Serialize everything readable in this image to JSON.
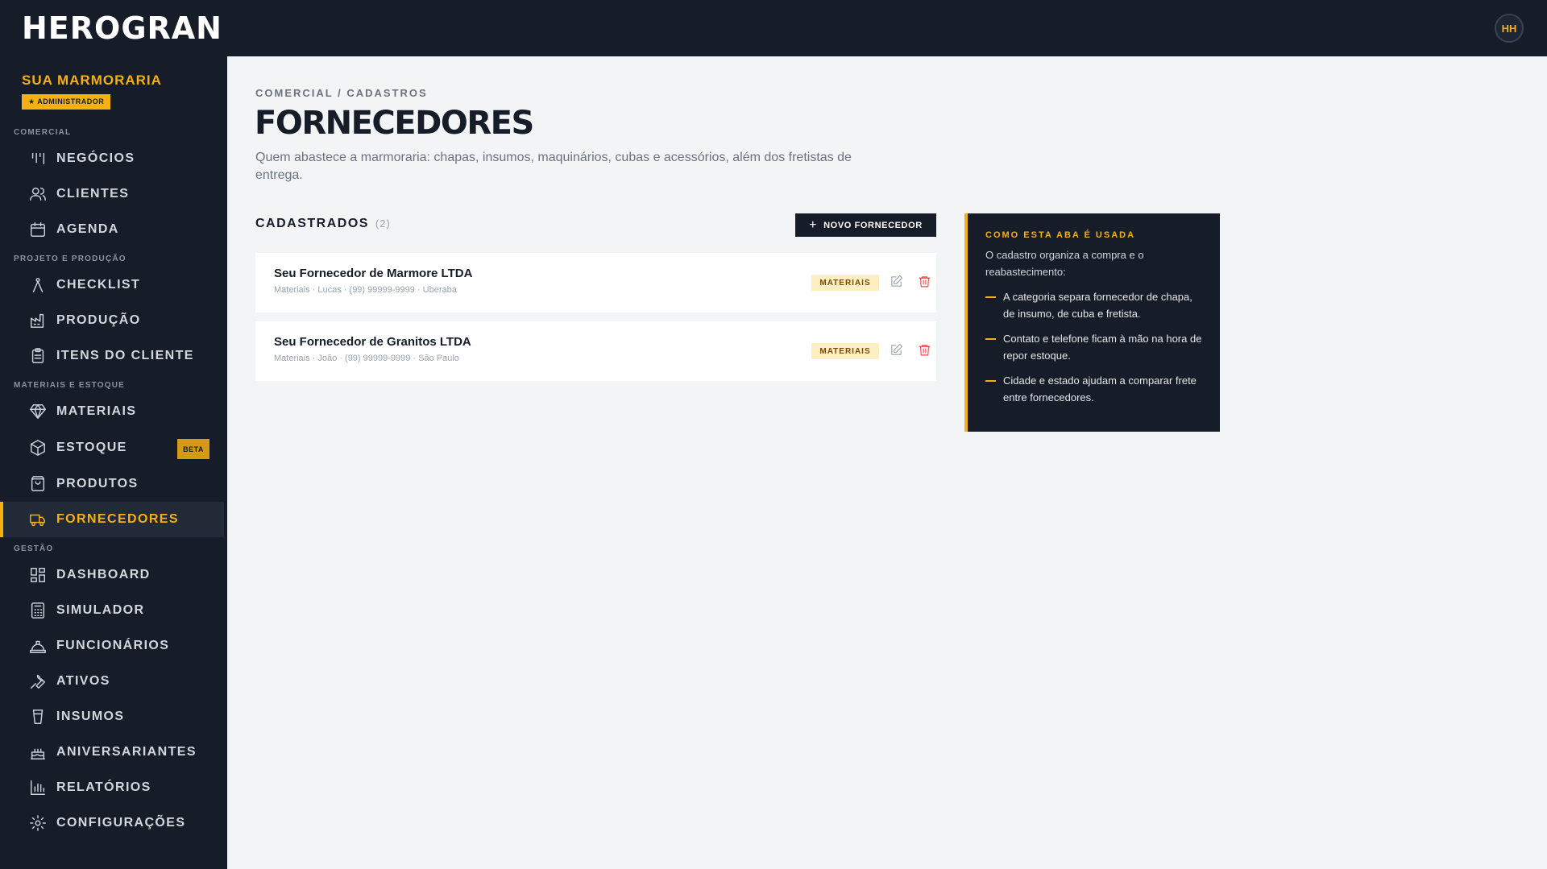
{
  "app": {
    "logo": "HEROGRAN",
    "user_initials": "HH"
  },
  "org": {
    "name": "SUA MARMORARIA",
    "role": "★ ADMINISTRADOR"
  },
  "nav": {
    "comercial": {
      "title": "COMERCIAL",
      "items": [
        {
          "label": "NEGÓCIOS",
          "icon": "kanban-icon"
        },
        {
          "label": "CLIENTES",
          "icon": "users-icon"
        },
        {
          "label": "AGENDA",
          "icon": "calendar-icon"
        }
      ]
    },
    "projeto": {
      "title": "PROJETO E PRODUÇÃO",
      "items": [
        {
          "label": "CHECKLIST",
          "icon": "compass-icon"
        },
        {
          "label": "PRODUÇÃO",
          "icon": "factory-icon"
        },
        {
          "label": "ITENS DO CLIENTE",
          "icon": "clipboard-icon"
        }
      ]
    },
    "materiais": {
      "title": "MATERIAIS E ESTOQUE",
      "items": [
        {
          "label": "MATERIAIS",
          "icon": "gem-icon"
        },
        {
          "label": "ESTOQUE",
          "icon": "box-icon",
          "badge": "BETA"
        },
        {
          "label": "PRODUTOS",
          "icon": "shopping-bag-icon"
        },
        {
          "label": "FORNECEDORES",
          "icon": "truck-icon",
          "active": true
        }
      ]
    },
    "gestao": {
      "title": "GESTÃO",
      "items": [
        {
          "label": "DASHBOARD",
          "icon": "dashboard-icon"
        },
        {
          "label": "SIMULADOR",
          "icon": "calculator-icon"
        },
        {
          "label": "FUNCIONÁRIOS",
          "icon": "hard-hat-icon"
        },
        {
          "label": "ATIVOS",
          "icon": "wrench-icon"
        },
        {
          "label": "INSUMOS",
          "icon": "cup-icon"
        },
        {
          "label": "ANIVERSARIANTES",
          "icon": "cake-icon"
        },
        {
          "label": "RELATÓRIOS",
          "icon": "bar-chart-icon"
        },
        {
          "label": "CONFIGURAÇÕES",
          "icon": "settings-icon"
        }
      ]
    }
  },
  "page": {
    "breadcrumb": "COMERCIAL / CADASTROS",
    "title": "FORNECEDORES",
    "description": "Quem abastece a marmoraria: chapas, insumos, maquinários, cubas e acessórios, além dos fretistas de entrega."
  },
  "list": {
    "title": "CADASTRADOS",
    "count": "(2)",
    "new_button": "NOVO FORNECEDOR",
    "suppliers": [
      {
        "name": "Seu Fornecedor de Marmore LTDA",
        "meta": "Materiais · Lucas · (99) 99999-9999 · Uberaba",
        "tag": "MATERIAIS"
      },
      {
        "name": "Seu Fornecedor de Granitos LTDA",
        "meta": "Materiais · João · (99) 99999-9999 · São Paulo",
        "tag": "MATERIAIS"
      }
    ]
  },
  "info": {
    "title": "COMO ESTA ABA É USADA",
    "intro": "O cadastro organiza a compra e o reabastecimento:",
    "points": [
      "A categoria separa fornecedor de chapa, de insumo, de cuba e fretista.",
      "Contato e telefone ficam à mão na hora de repor estoque.",
      "Cidade e estado ajudam a comparar frete entre fornecedores."
    ]
  },
  "colors": {
    "accent": "#f5b014",
    "dark": "#161d29",
    "danger": "#ef4444",
    "tag_bg": "#fdeec4"
  }
}
